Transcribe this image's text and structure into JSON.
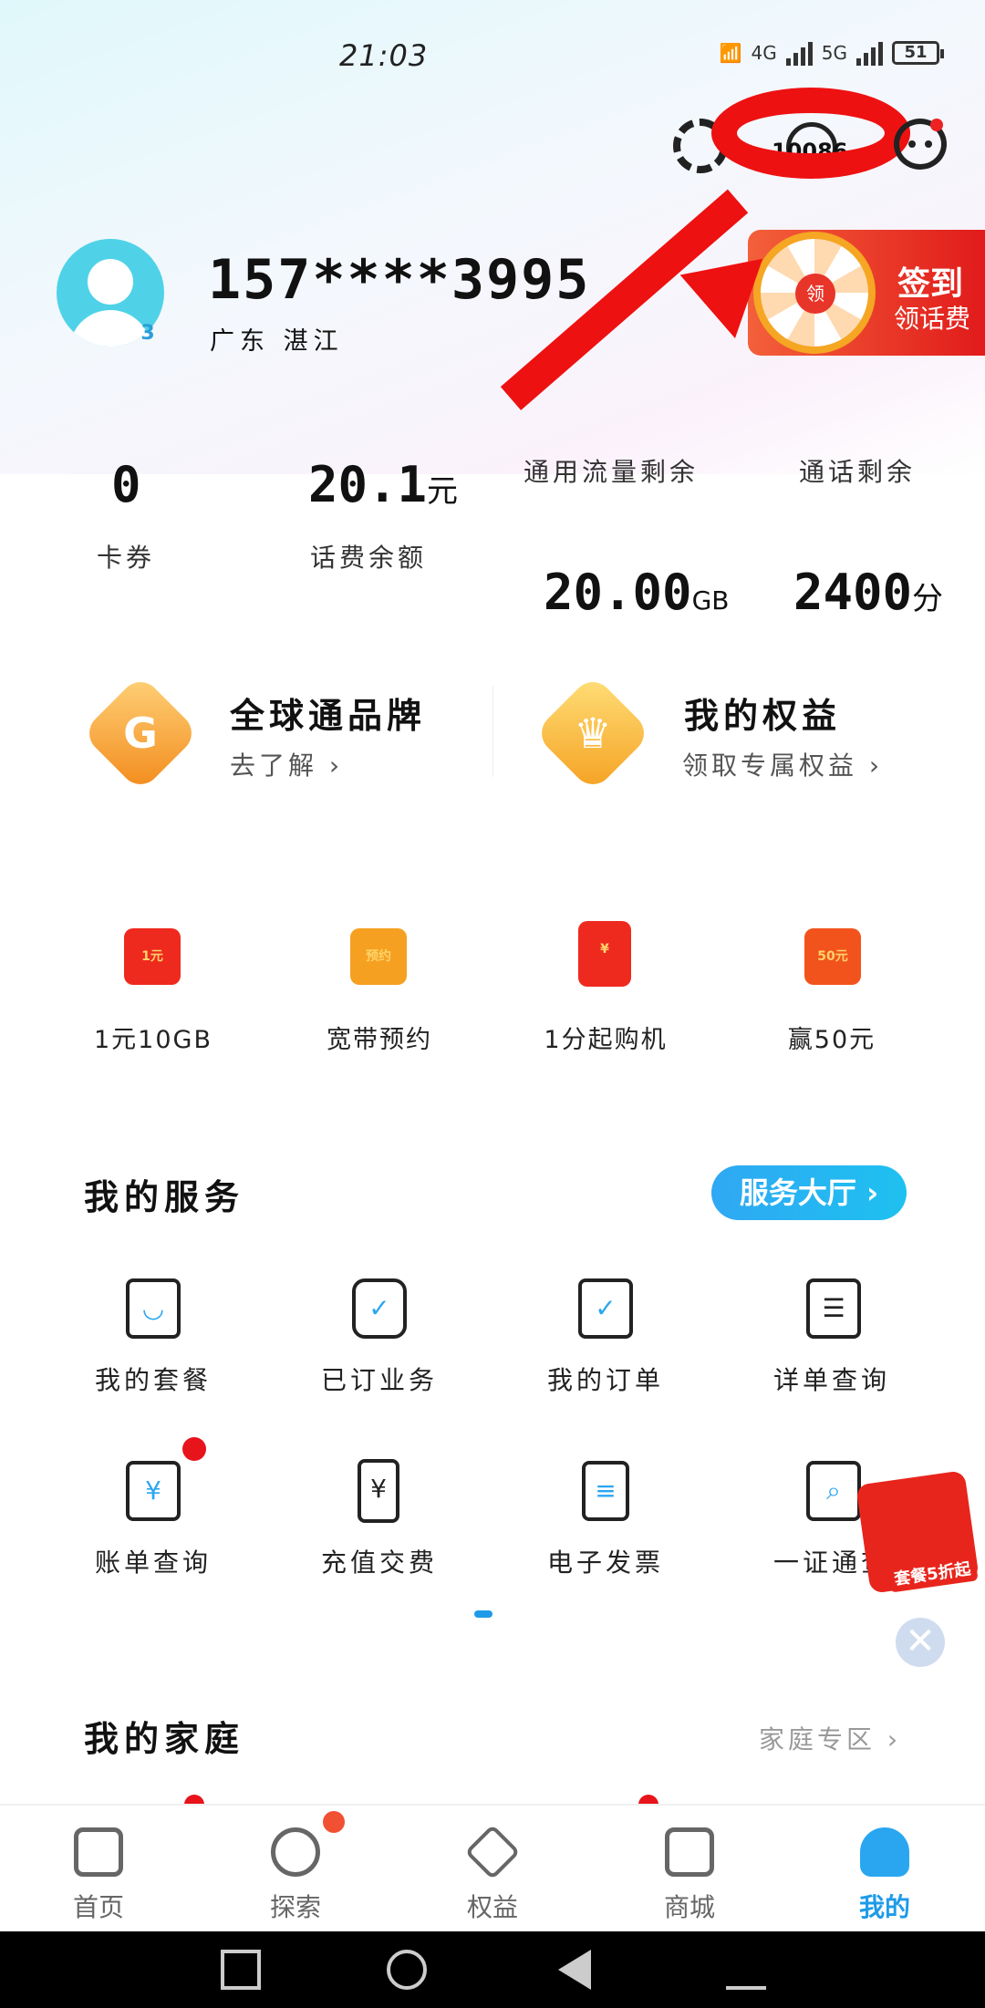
{
  "status_bar": {
    "time": "21:03",
    "net_4g": "4G",
    "net_5g": "5G",
    "battery": "51"
  },
  "header": {
    "service_hotline": "10086"
  },
  "profile": {
    "phone": "157****3995",
    "region": "广东 湛江",
    "level": "3"
  },
  "promo": {
    "wheel_label": "领",
    "title": "签到",
    "subtitle": "领话费"
  },
  "balance": {
    "coupon_value": "0",
    "coupon_label": "卡券",
    "fee_value": "20.1",
    "fee_unit": "元",
    "fee_label": "话费余额",
    "data_label": "通用流量剩余",
    "data_value": "20.00",
    "data_unit": "GB",
    "voice_label": "通话剩余",
    "voice_value": "2400",
    "voice_unit": "分"
  },
  "brands": [
    {
      "title": "全球通品牌",
      "subtitle": "去了解 ›"
    },
    {
      "title": "我的权益",
      "subtitle": "领取专属权益 ›"
    }
  ],
  "quick_actions": [
    {
      "label": "1元10GB",
      "icon_text": "1元"
    },
    {
      "label": "宽带预约",
      "icon_text": "预约"
    },
    {
      "label": "1分起购机",
      "icon_text": "¥"
    },
    {
      "label": "赢50元",
      "icon_text": "50元"
    }
  ],
  "services": {
    "title": "我的服务",
    "hall_button": "服务大厅 ›",
    "items": [
      {
        "label": "我的套餐",
        "glyph": "◡"
      },
      {
        "label": "已订业务",
        "glyph": "✓"
      },
      {
        "label": "我的订单",
        "glyph": "✓"
      },
      {
        "label": "详单查询",
        "glyph": "☰"
      },
      {
        "label": "账单查询",
        "glyph": "¥"
      },
      {
        "label": "充值交费",
        "glyph": "¥"
      },
      {
        "label": "电子发票",
        "glyph": "≡"
      },
      {
        "label": "一证通查",
        "glyph": "⌕"
      }
    ]
  },
  "floating_gift": {
    "label": "套餐5折起",
    "close": "✕"
  },
  "family": {
    "title": "我的家庭",
    "link": "家庭专区 ›"
  },
  "bottom_nav": [
    {
      "label": "首页"
    },
    {
      "label": "探索"
    },
    {
      "label": "权益"
    },
    {
      "label": "商城"
    },
    {
      "label": "我的"
    }
  ],
  "colors": {
    "accent": "#1e9be8",
    "annotation_red": "#ee1111",
    "badge_red": "#e8141b"
  }
}
